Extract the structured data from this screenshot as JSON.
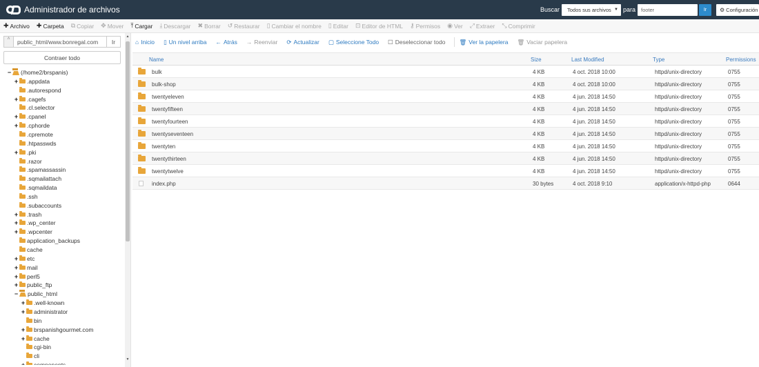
{
  "header": {
    "title": "Administrador de archivos",
    "search_label": "Buscar",
    "search_scope": "Todos sus archivos",
    "para_label": "para",
    "search_value": "footer",
    "go_label": "Ir",
    "settings_label": "Configuración"
  },
  "toolbar": [
    {
      "icon": "plus-icon",
      "glyph": "✚",
      "label": "Archivo",
      "enabled": true
    },
    {
      "icon": "plus-icon",
      "glyph": "✚",
      "label": "Carpeta",
      "enabled": true
    },
    {
      "icon": "copy-icon",
      "glyph": "⧉",
      "label": "Copiar",
      "enabled": false
    },
    {
      "icon": "move-icon",
      "glyph": "✥",
      "label": "Mover",
      "enabled": false
    },
    {
      "icon": "upload-icon",
      "glyph": "⤒",
      "label": "Cargar",
      "enabled": true
    },
    {
      "icon": "download-icon",
      "glyph": "⤓",
      "label": "Descargar",
      "enabled": false
    },
    {
      "icon": "delete-icon",
      "glyph": "✖",
      "label": "Borrar",
      "enabled": false
    },
    {
      "icon": "restore-icon",
      "glyph": "↺",
      "label": "Restaurar",
      "enabled": false
    },
    {
      "icon": "rename-icon",
      "glyph": "▯",
      "label": "Cambiar el nombre",
      "enabled": false
    },
    {
      "icon": "edit-icon",
      "glyph": "▯",
      "label": "Editar",
      "enabled": false
    },
    {
      "icon": "html-editor-icon",
      "glyph": "⊡",
      "label": "Editor de HTML",
      "enabled": false
    },
    {
      "icon": "permissions-icon",
      "glyph": "⚷",
      "label": "Permisos",
      "enabled": false
    },
    {
      "icon": "view-icon",
      "glyph": "◉",
      "label": "Ver",
      "enabled": false
    },
    {
      "icon": "extract-icon",
      "glyph": "⤢",
      "label": "Extraer",
      "enabled": false
    },
    {
      "icon": "compress-icon",
      "glyph": "⤡",
      "label": "Comprimir",
      "enabled": false
    }
  ],
  "left": {
    "path_value": "public_html/www.bonregal.com",
    "go_label": "Ir",
    "collapse_label": "Contraer todo"
  },
  "tree": [
    {
      "label": "(/home2/brspanis)",
      "level": 0,
      "toggle": "−",
      "open": true
    },
    {
      "label": ".appdata",
      "level": 1,
      "toggle": "+"
    },
    {
      "label": ".autorespond",
      "level": 1,
      "toggle": ""
    },
    {
      "label": ".cagefs",
      "level": 1,
      "toggle": "+"
    },
    {
      "label": ".cl.selector",
      "level": 1,
      "toggle": ""
    },
    {
      "label": ".cpanel",
      "level": 1,
      "toggle": "+"
    },
    {
      "label": ".cphorde",
      "level": 1,
      "toggle": "+"
    },
    {
      "label": ".cpremote",
      "level": 1,
      "toggle": ""
    },
    {
      "label": ".htpasswds",
      "level": 1,
      "toggle": ""
    },
    {
      "label": ".pki",
      "level": 1,
      "toggle": "+"
    },
    {
      "label": ".razor",
      "level": 1,
      "toggle": ""
    },
    {
      "label": ".spamassassin",
      "level": 1,
      "toggle": ""
    },
    {
      "label": ".sqmailattach",
      "level": 1,
      "toggle": ""
    },
    {
      "label": ".sqmaildata",
      "level": 1,
      "toggle": ""
    },
    {
      "label": ".ssh",
      "level": 1,
      "toggle": ""
    },
    {
      "label": ".subaccounts",
      "level": 1,
      "toggle": ""
    },
    {
      "label": ".trash",
      "level": 1,
      "toggle": "+"
    },
    {
      "label": ".wp_center",
      "level": 1,
      "toggle": "+"
    },
    {
      "label": ".wpcenter",
      "level": 1,
      "toggle": "+"
    },
    {
      "label": "application_backups",
      "level": 1,
      "toggle": ""
    },
    {
      "label": "cache",
      "level": 1,
      "toggle": ""
    },
    {
      "label": "etc",
      "level": 1,
      "toggle": "+"
    },
    {
      "label": "mail",
      "level": 1,
      "toggle": "+"
    },
    {
      "label": "perl5",
      "level": 1,
      "toggle": "+"
    },
    {
      "label": "public_ftp",
      "level": 1,
      "toggle": "+"
    },
    {
      "label": "public_html",
      "level": 1,
      "toggle": "−",
      "open": true
    },
    {
      "label": ".well-known",
      "level": 2,
      "toggle": "+"
    },
    {
      "label": "administrator",
      "level": 2,
      "toggle": "+"
    },
    {
      "label": "bin",
      "level": 2,
      "toggle": ""
    },
    {
      "label": "brspanishgourmet.com",
      "level": 2,
      "toggle": "+"
    },
    {
      "label": "cache",
      "level": 2,
      "toggle": "+"
    },
    {
      "label": "cgi-bin",
      "level": 2,
      "toggle": ""
    },
    {
      "label": "cli",
      "level": 2,
      "toggle": ""
    },
    {
      "label": "components",
      "level": 2,
      "toggle": "+"
    }
  ],
  "nav": [
    {
      "icon": "home-icon",
      "glyph": "⌂",
      "label": "Inicio",
      "style": "link"
    },
    {
      "icon": "level-up-icon",
      "glyph": "▯",
      "label": "Un nivel arriba",
      "style": "link"
    },
    {
      "icon": "back-icon",
      "glyph": "←",
      "label": "Atrás",
      "style": "link"
    },
    {
      "icon": "forward-icon",
      "glyph": "→",
      "label": "Reenviar",
      "style": "disabled"
    },
    {
      "icon": "reload-icon",
      "glyph": "⟳",
      "label": "Actualizar",
      "style": "link"
    },
    {
      "icon": "select-all-icon",
      "glyph": "▢",
      "label": "Seleccione Todo",
      "style": "link"
    },
    {
      "icon": "deselect-icon",
      "glyph": "☐",
      "label": "Deseleccionar todo",
      "style": "grey"
    },
    {
      "icon": "trash-icon",
      "glyph": "🗑",
      "label": "Ver la papelera",
      "style": "link"
    },
    {
      "icon": "empty-trash-icon",
      "glyph": "🗑",
      "label": "Vaciar papelera",
      "style": "disabled"
    }
  ],
  "table": {
    "columns": [
      "Name",
      "Size",
      "Last Modified",
      "Type",
      "Permissions"
    ],
    "rows": [
      {
        "kind": "folder",
        "name": "bulk",
        "size": "4 KB",
        "modified": "4 oct. 2018 10:00",
        "type": "httpd/unix-directory",
        "perms": "0755"
      },
      {
        "kind": "folder",
        "name": "bulk-shop",
        "size": "4 KB",
        "modified": "4 oct. 2018 10:00",
        "type": "httpd/unix-directory",
        "perms": "0755"
      },
      {
        "kind": "folder",
        "name": "twentyeleven",
        "size": "4 KB",
        "modified": "4 jun. 2018 14:50",
        "type": "httpd/unix-directory",
        "perms": "0755"
      },
      {
        "kind": "folder",
        "name": "twentyfifteen",
        "size": "4 KB",
        "modified": "4 jun. 2018 14:50",
        "type": "httpd/unix-directory",
        "perms": "0755"
      },
      {
        "kind": "folder",
        "name": "twentyfourteen",
        "size": "4 KB",
        "modified": "4 jun. 2018 14:50",
        "type": "httpd/unix-directory",
        "perms": "0755"
      },
      {
        "kind": "folder",
        "name": "twentyseventeen",
        "size": "4 KB",
        "modified": "4 jun. 2018 14:50",
        "type": "httpd/unix-directory",
        "perms": "0755"
      },
      {
        "kind": "folder",
        "name": "twentyten",
        "size": "4 KB",
        "modified": "4 jun. 2018 14:50",
        "type": "httpd/unix-directory",
        "perms": "0755"
      },
      {
        "kind": "folder",
        "name": "twentythirteen",
        "size": "4 KB",
        "modified": "4 jun. 2018 14:50",
        "type": "httpd/unix-directory",
        "perms": "0755"
      },
      {
        "kind": "folder",
        "name": "twentytwelve",
        "size": "4 KB",
        "modified": "4 jun. 2018 14:50",
        "type": "httpd/unix-directory",
        "perms": "0755"
      },
      {
        "kind": "file",
        "name": "index.php",
        "size": "30 bytes",
        "modified": "4 oct. 2018 9:10",
        "type": "application/x-httpd-php",
        "perms": "0644"
      }
    ]
  }
}
